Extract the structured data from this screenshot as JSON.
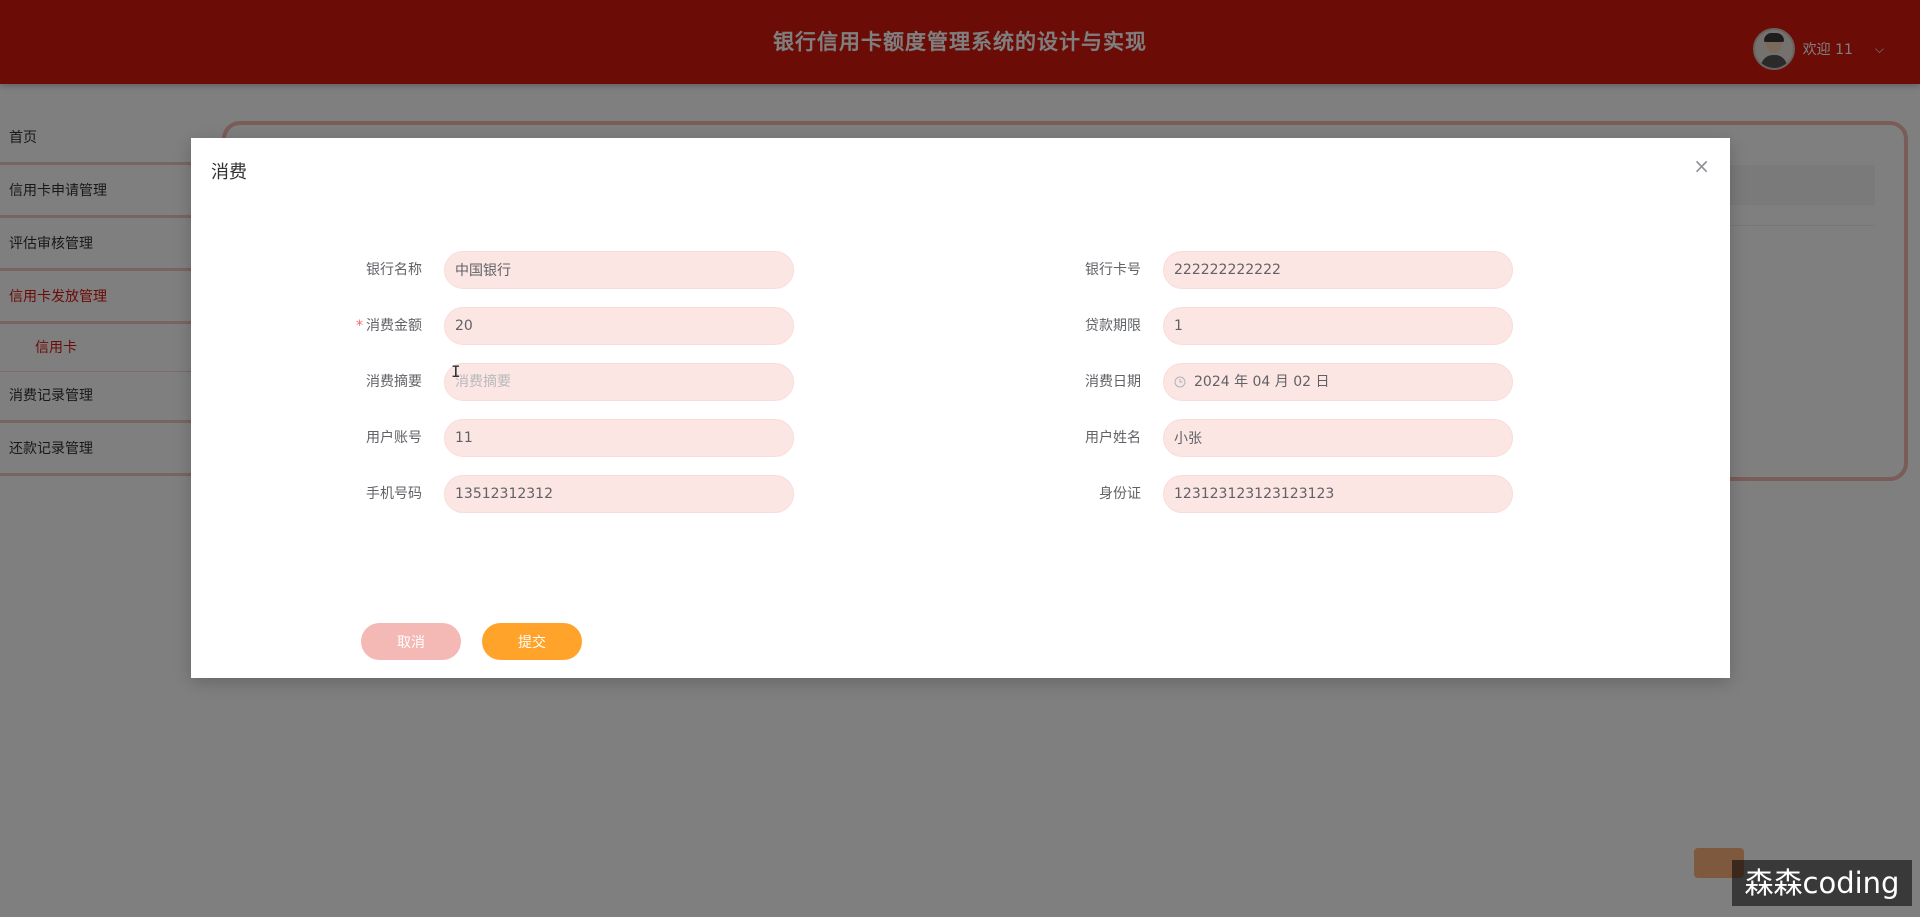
{
  "header": {
    "title": "银行信用卡额度管理系统的设计与实现",
    "welcome": "欢迎 11",
    "chevron": "⌵"
  },
  "sidebar": {
    "items": [
      {
        "label": "首页"
      },
      {
        "label": "信用卡申请管理"
      },
      {
        "label": "评估审核管理"
      },
      {
        "label": "信用卡发放管理"
      },
      {
        "label": "消费记录管理"
      },
      {
        "label": "还款记录管理"
      }
    ],
    "sub_item": "信用卡"
  },
  "dialog": {
    "title": "消费",
    "close": "×",
    "fields": {
      "bank_name": {
        "label": "银行名称",
        "value": "中国银行"
      },
      "card_no": {
        "label": "银行卡号",
        "value": "222222222222"
      },
      "amount": {
        "label": "消费金额",
        "value": "20",
        "required_mark": "*"
      },
      "loan_term": {
        "label": "贷款期限",
        "value": "1"
      },
      "summary": {
        "label": "消费摘要",
        "value": "",
        "placeholder": "消费摘要"
      },
      "date": {
        "label": "消费日期",
        "value": "2024 年 04 月 02 日"
      },
      "account": {
        "label": "用户账号",
        "value": "11"
      },
      "username": {
        "label": "用户姓名",
        "value": "小张"
      },
      "phone": {
        "label": "手机号码",
        "value": "13512312312"
      },
      "id_card": {
        "label": "身份证",
        "value": "123123123123123123"
      }
    },
    "buttons": {
      "cancel": "取消",
      "submit": "提交"
    }
  },
  "watermark": "森森coding",
  "colors": {
    "header": "#d8180e",
    "input_bg": "#fbe6e4",
    "submit": "#ffa32a",
    "cancel": "#f4b9b4"
  }
}
